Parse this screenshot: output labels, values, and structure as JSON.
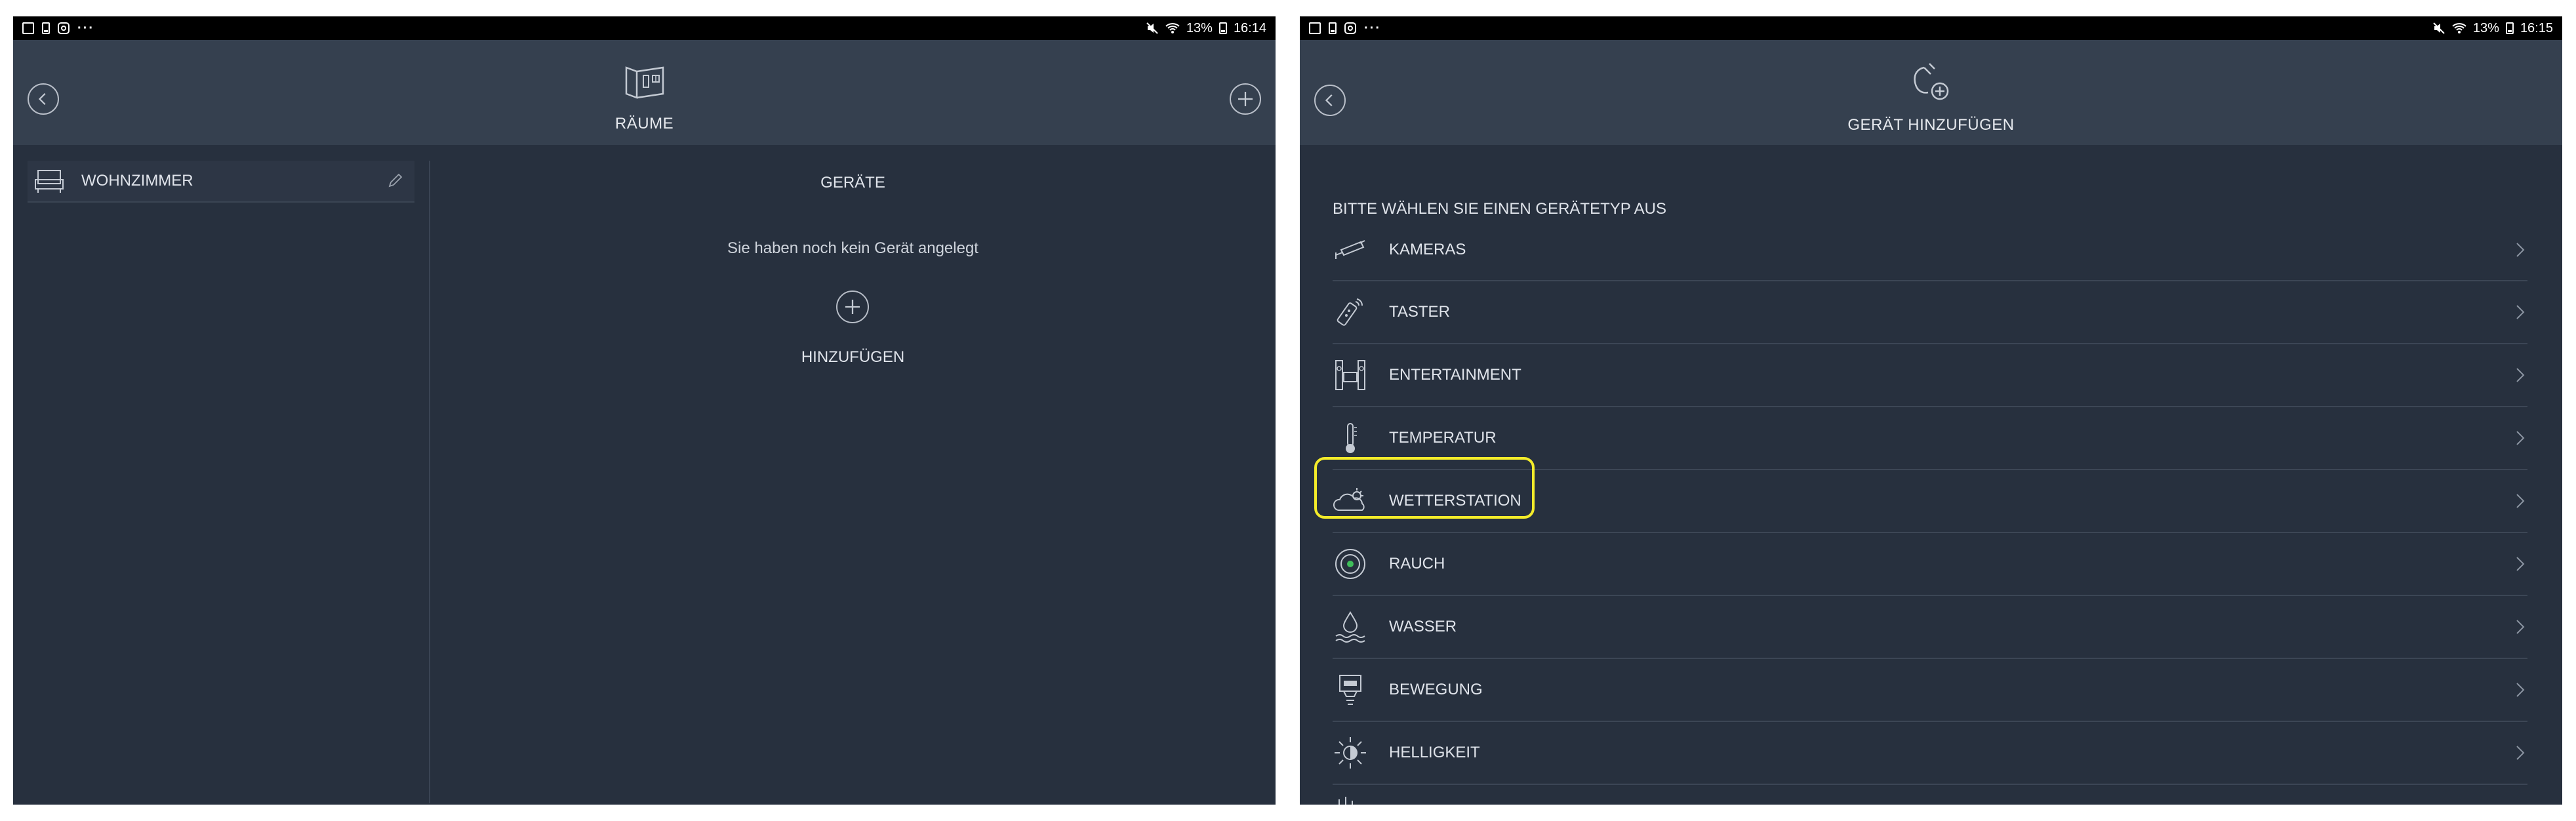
{
  "left_screen": {
    "status": {
      "battery": "13%",
      "time": "16:14"
    },
    "appbar": {
      "title": "RÄUME"
    },
    "rooms": [
      {
        "label": "WOHNZIMMER"
      }
    ],
    "devices_header": "GERÄTE",
    "empty_message": "Sie haben noch kein Gerät angelegt",
    "add_label": "HINZUFÜGEN"
  },
  "right_screen": {
    "status": {
      "battery": "13%",
      "time": "16:15"
    },
    "appbar": {
      "title": "GERÄT HINZUFÜGEN"
    },
    "section_title": "BITTE WÄHLEN SIE EINEN GERÄTETYP AUS",
    "device_types": [
      {
        "label": "KAMERAS",
        "icon": "camera-icon"
      },
      {
        "label": "TASTER",
        "icon": "remote-icon"
      },
      {
        "label": "ENTERTAINMENT",
        "icon": "entertainment-icon"
      },
      {
        "label": "TEMPERATUR",
        "icon": "thermometer-icon"
      },
      {
        "label": "WETTERSTATION",
        "icon": "weather-icon"
      },
      {
        "label": "RAUCH",
        "icon": "smoke-detector-icon"
      },
      {
        "label": "WASSER",
        "icon": "water-icon"
      },
      {
        "label": "BEWEGUNG",
        "icon": "motion-sensor-icon"
      },
      {
        "label": "HELLIGKEIT",
        "icon": "brightness-icon"
      }
    ]
  },
  "colors": {
    "background": "#27303e",
    "appbar": "#35404f",
    "highlight": "#f4ec2a"
  }
}
